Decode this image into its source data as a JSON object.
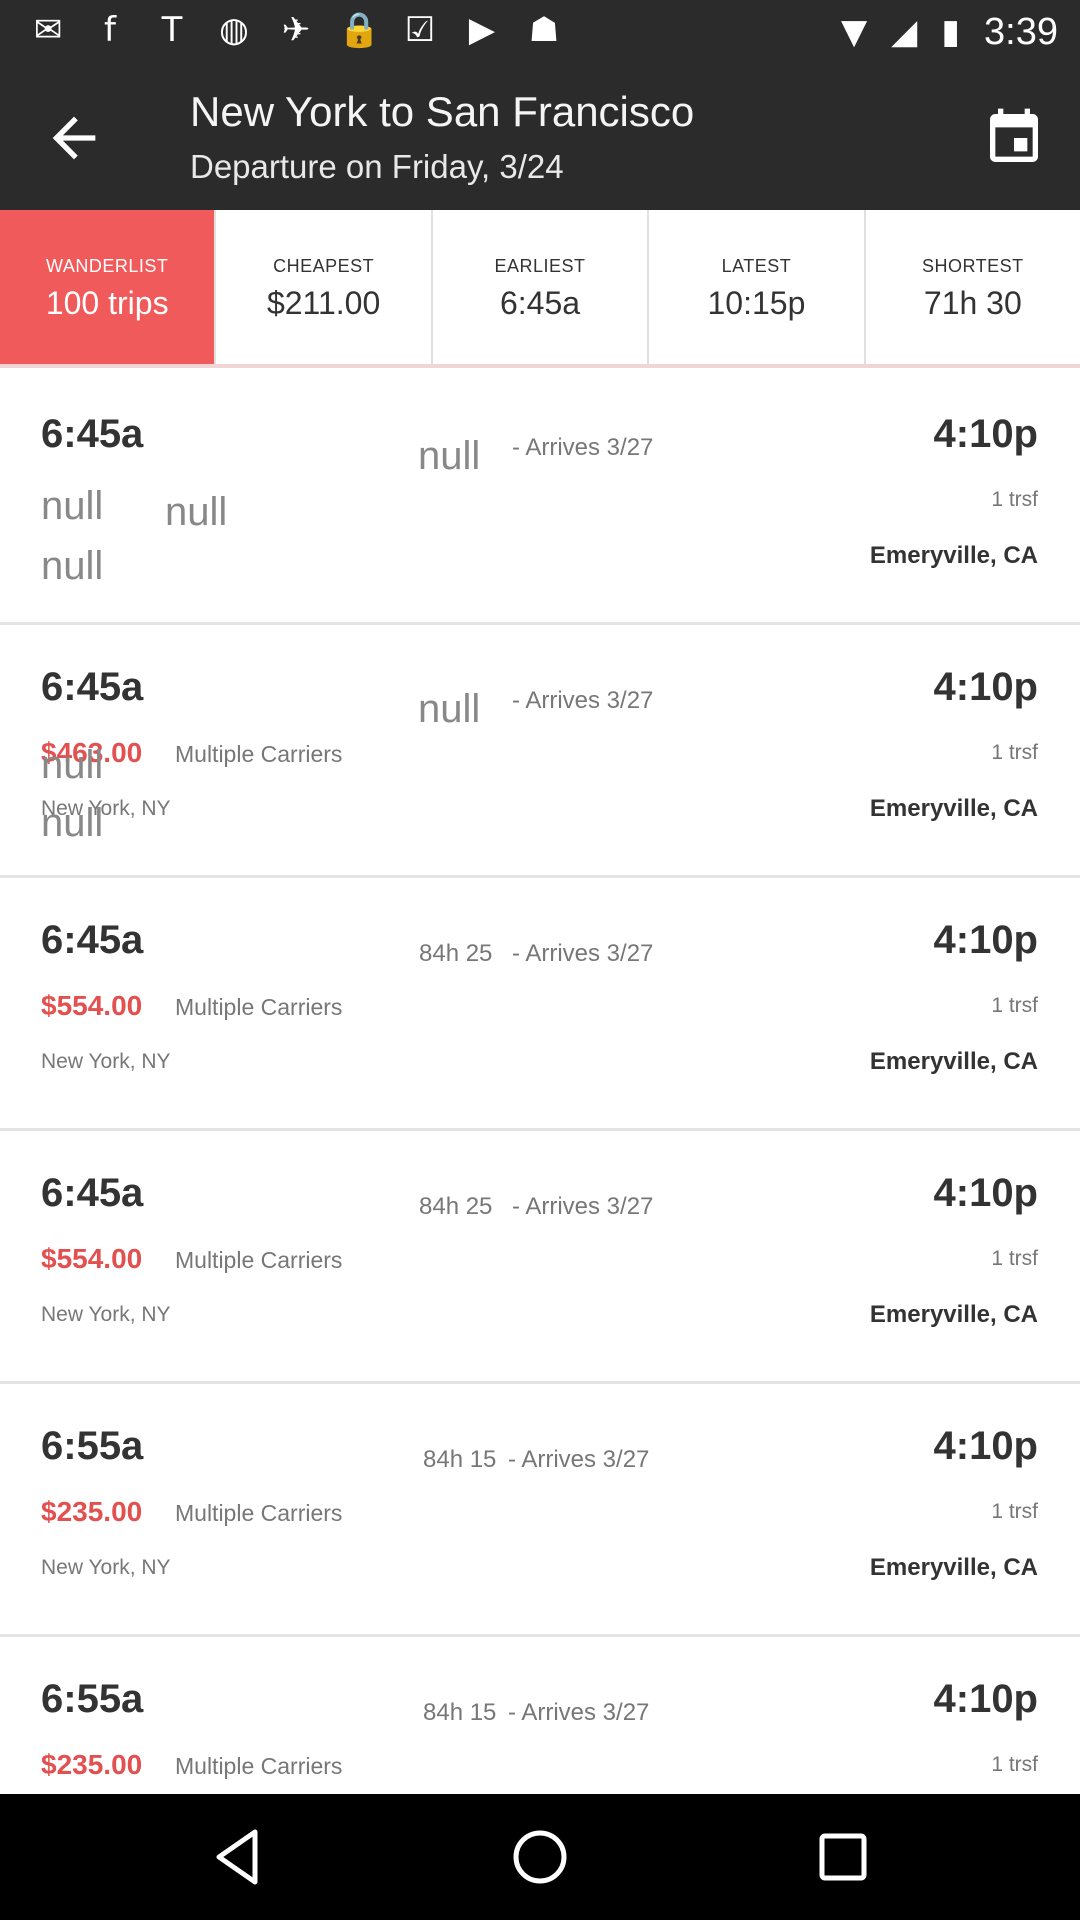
{
  "status_bar": {
    "icons": [
      "mail-icon",
      "facebook-icon",
      "text-icon",
      "circle-icon",
      "fake-gps-icon",
      "lock-icon",
      "clipboard-icon",
      "play-store-icon",
      "android-icon"
    ],
    "time": "3:39"
  },
  "app_bar": {
    "title": "New York to San Francisco",
    "subtitle": "Departure on Friday, 3/24"
  },
  "sort_tabs": [
    {
      "label": "WANDERLIST",
      "value": "100 trips",
      "active": true
    },
    {
      "label": "CHEAPEST",
      "value": "$211.00",
      "active": false
    },
    {
      "label": "EARLIEST",
      "value": "6:45a",
      "active": false
    },
    {
      "label": "LATEST",
      "value": "10:15p",
      "active": false
    },
    {
      "label": "SHORTEST",
      "value": "71h 30",
      "active": false
    }
  ],
  "trips": [
    {
      "depart": "6:45a",
      "duration": "null",
      "arrives": "- Arrives 3/27",
      "arrive_time": "4:10p",
      "price": "null",
      "carrier": "null",
      "stops": "1 trsf",
      "origin": "null",
      "destination": "Emeryville, CA"
    },
    {
      "depart": "6:45a",
      "duration": "null",
      "arrives": "- Arrives 3/27",
      "arrive_time": "4:10p",
      "price": "$463.00",
      "carrier": "Multiple Carriers",
      "stops": "1 trsf",
      "origin": "New York, NY",
      "destination": "Emeryville, CA",
      "overlay_nulls": [
        "null",
        "null"
      ]
    },
    {
      "depart": "6:45a",
      "duration": "84h 25",
      "arrives": "- Arrives 3/27",
      "arrive_time": "4:10p",
      "price": "$554.00",
      "carrier": "Multiple Carriers",
      "stops": "1 trsf",
      "origin": "New York, NY",
      "destination": "Emeryville, CA"
    },
    {
      "depart": "6:45a",
      "duration": "84h 25",
      "arrives": "- Arrives 3/27",
      "arrive_time": "4:10p",
      "price": "$554.00",
      "carrier": "Multiple Carriers",
      "stops": "1 trsf",
      "origin": "New York, NY",
      "destination": "Emeryville, CA"
    },
    {
      "depart": "6:55a",
      "duration": "84h 15",
      "arrives": "- Arrives 3/27",
      "arrive_time": "4:10p",
      "price": "$235.00",
      "carrier": "Multiple Carriers",
      "stops": "1 trsf",
      "origin": "New York, NY",
      "destination": "Emeryville, CA"
    },
    {
      "depart": "6:55a",
      "duration": "84h 15",
      "arrives": "- Arrives 3/27",
      "arrive_time": "4:10p",
      "price": "$235.00",
      "carrier": "Multiple Carriers",
      "stops": "1 trsf",
      "origin": "",
      "destination": ""
    }
  ],
  "colors": {
    "accent": "#f05a5a",
    "price": "#e25050",
    "app_bar": "#2b2b2b"
  }
}
